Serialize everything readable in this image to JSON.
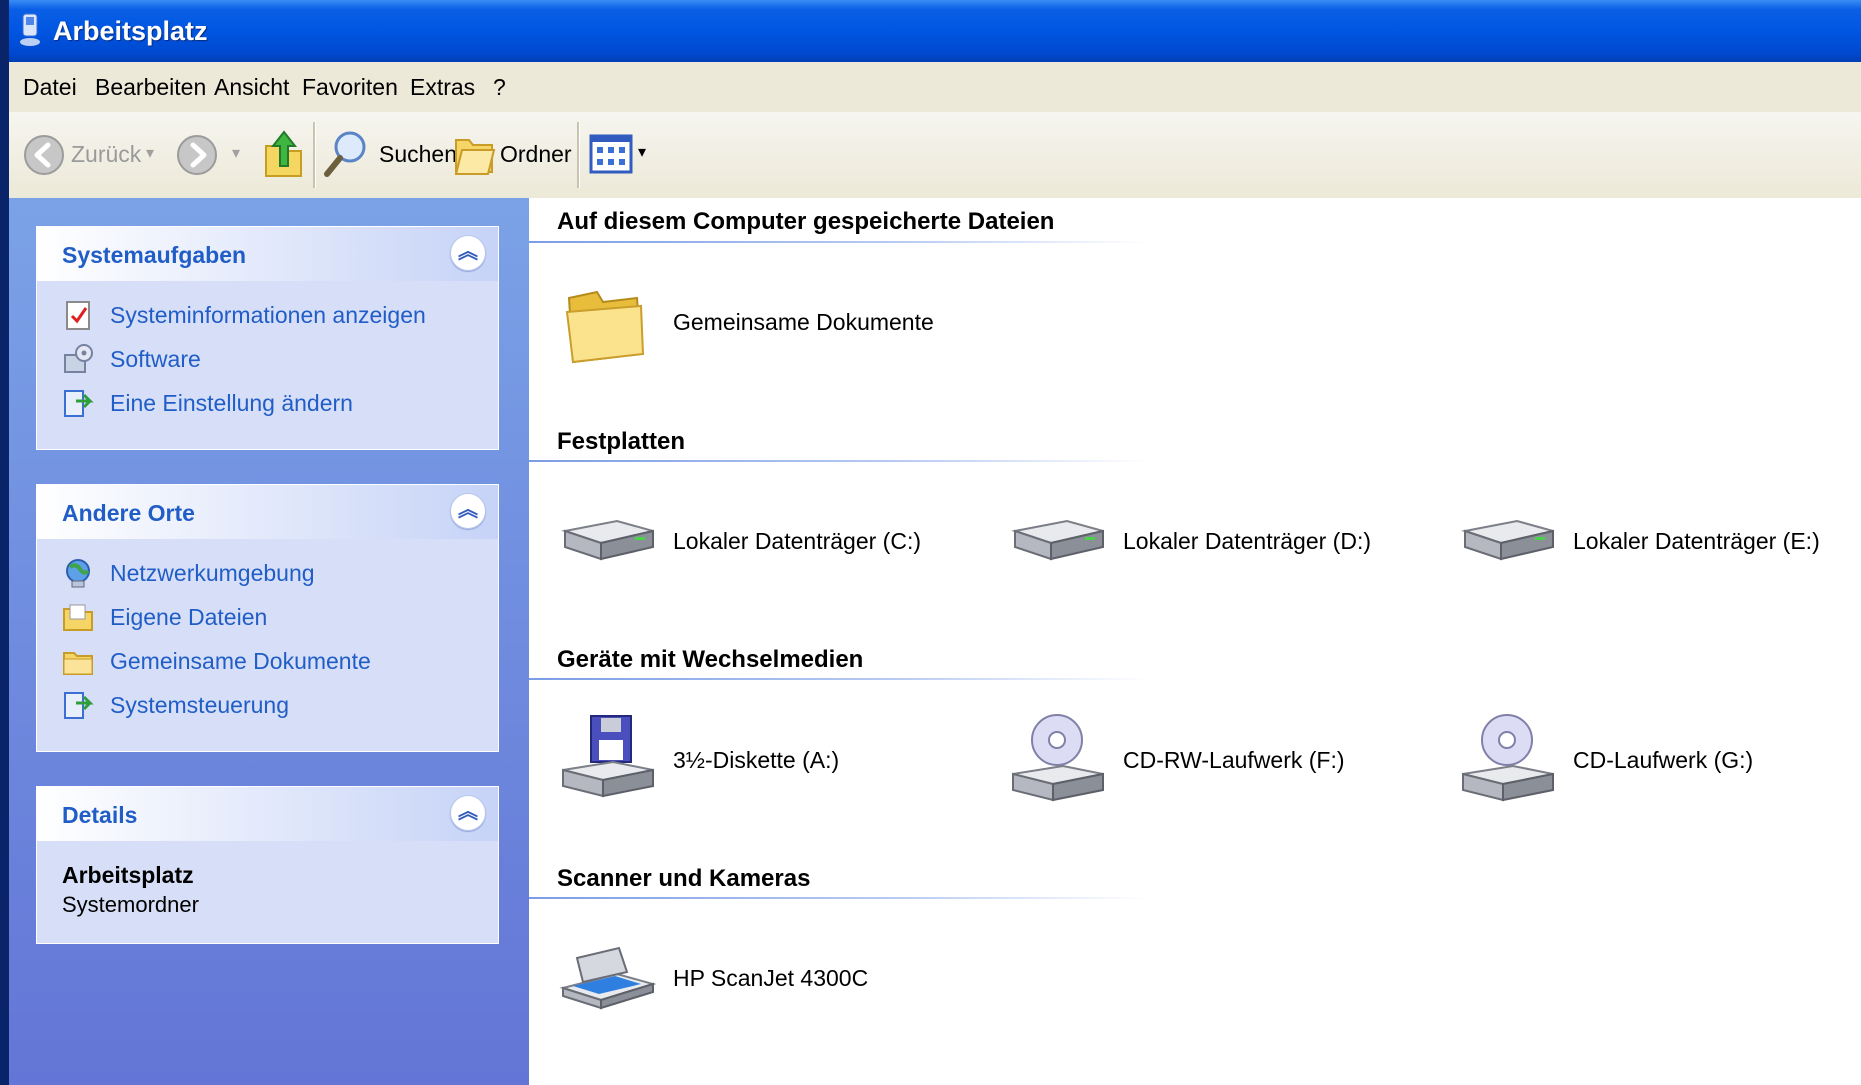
{
  "window": {
    "title": "Arbeitsplatz"
  },
  "menu": [
    "Datei",
    "Bearbeiten",
    "Ansicht",
    "Favoriten",
    "Extras",
    "?"
  ],
  "toolbar": {
    "back_label": "Zurück",
    "search_label": "Suchen",
    "folders_label": "Ordner"
  },
  "sidebar": {
    "system_tasks": {
      "title": "Systemaufgaben",
      "items": [
        {
          "label": "Systeminformationen anzeigen",
          "icon": "system-info-icon"
        },
        {
          "label": "Software",
          "icon": "software-icon"
        },
        {
          "label": "Eine Einstellung ändern",
          "icon": "settings-icon"
        }
      ]
    },
    "other_places": {
      "title": "Andere Orte",
      "items": [
        {
          "label": "Netzwerkumgebung",
          "icon": "network-icon"
        },
        {
          "label": "Eigene Dateien",
          "icon": "my-documents-icon"
        },
        {
          "label": "Gemeinsame Dokumente",
          "icon": "folder-icon"
        },
        {
          "label": "Systemsteuerung",
          "icon": "control-panel-icon"
        }
      ]
    },
    "details": {
      "title": "Details",
      "name": "Arbeitsplatz",
      "type": "Systemordner"
    }
  },
  "content": {
    "groups": [
      {
        "title": "Auf diesem Computer gespeicherte Dateien",
        "items": [
          {
            "label": "Gemeinsame Dokumente",
            "icon": "folder-icon"
          }
        ]
      },
      {
        "title": "Festplatten",
        "items": [
          {
            "label": "Lokaler Datenträger (C:)",
            "icon": "hard-drive-icon"
          },
          {
            "label": "Lokaler Datenträger (D:)",
            "icon": "hard-drive-icon"
          },
          {
            "label": "Lokaler Datenträger (E:)",
            "icon": "hard-drive-icon"
          }
        ]
      },
      {
        "title": "Geräte mit Wechselmedien",
        "items": [
          {
            "label": "3½-Diskette (A:)",
            "icon": "floppy-drive-icon"
          },
          {
            "label": "CD-RW-Laufwerk (F:)",
            "icon": "cd-drive-icon"
          },
          {
            "label": "CD-Laufwerk (G:)",
            "icon": "cd-drive-icon"
          }
        ]
      },
      {
        "title": "Scanner und Kameras",
        "items": [
          {
            "label": "HP ScanJet 4300C",
            "icon": "scanner-icon"
          }
        ]
      }
    ]
  },
  "colors": {
    "title_bar": "#0054e3",
    "sidebar_link": "#215dc6",
    "sidebar_bg": "#6c8ae0",
    "group_line": "#7b9de6"
  }
}
